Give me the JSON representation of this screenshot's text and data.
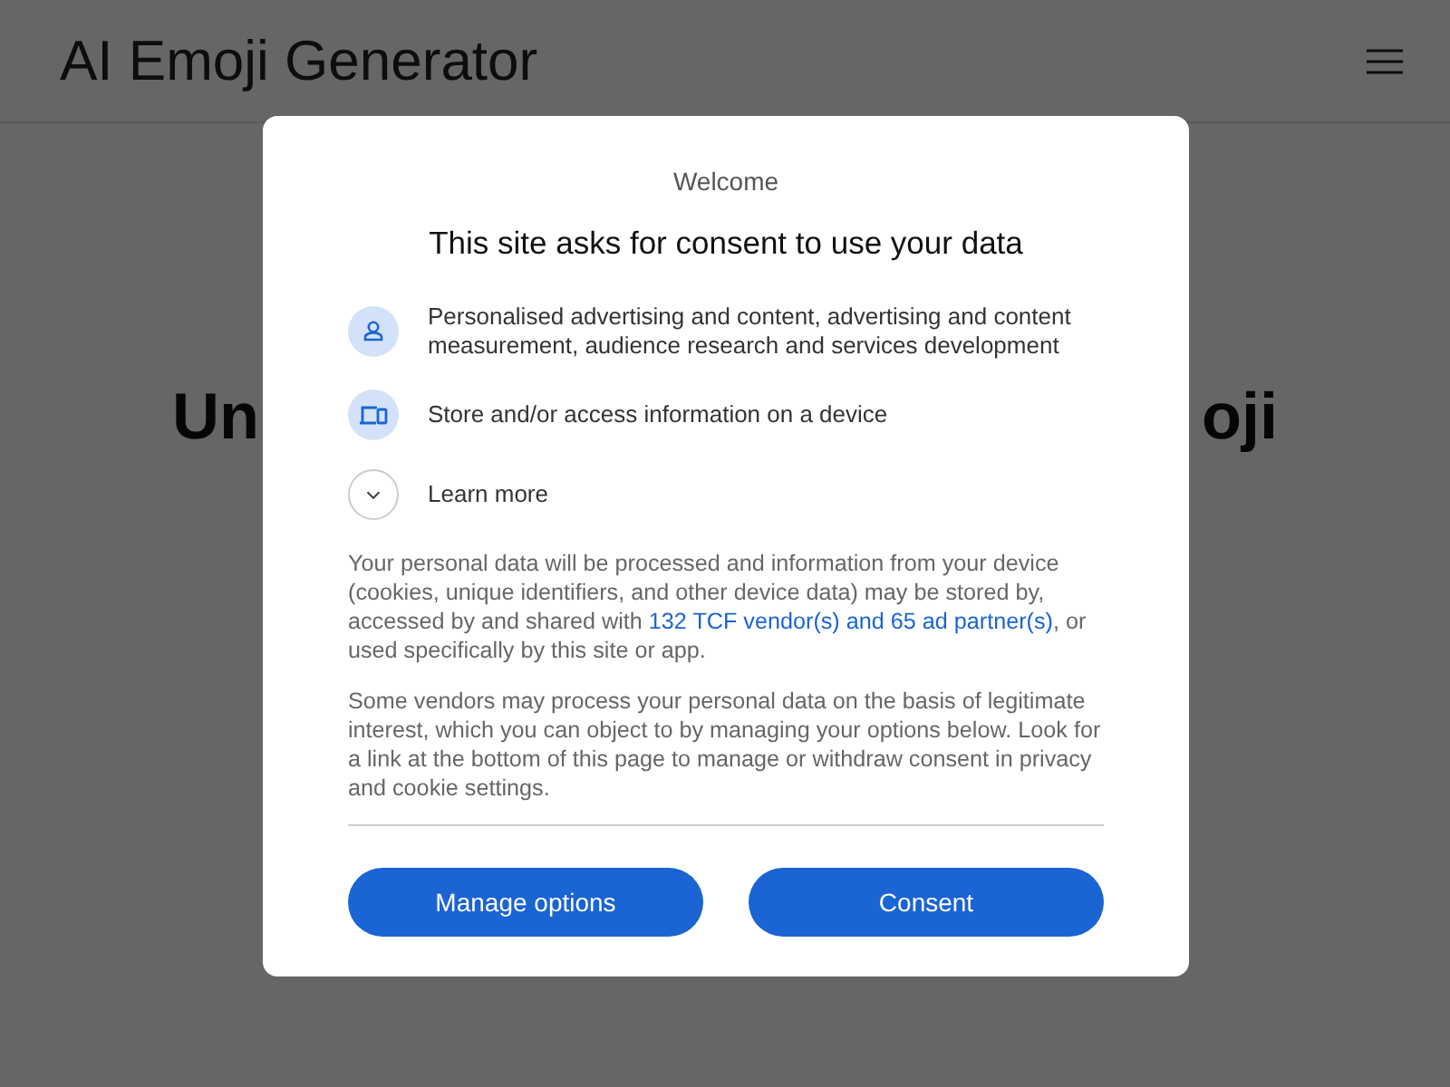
{
  "page": {
    "title": "AI Emoji Generator",
    "heading_left": "Un",
    "heading_right": "oji"
  },
  "dialog": {
    "eyebrow": "Welcome",
    "title": "This site asks for consent to use your data",
    "purposes": [
      {
        "kind": "person",
        "text": "Personalised advertising and content, advertising and content measurement, audience research and services development"
      },
      {
        "kind": "device",
        "text": "Store and/or access information on a device"
      }
    ],
    "learn_more": {
      "label": "Learn more",
      "expanded": false
    },
    "paragraphs": [
      {
        "before": "Your personal data will be processed and information from your device (cookies, unique identifiers, and other device data) may be stored by, accessed by and shared with ",
        "link": "132 TCF vendor(s) and 65 ad partner(s)",
        "after": ", or used specifically by this site or app."
      },
      {
        "before": "Some vendors may process your personal data on the basis of legitimate interest, which you can object to by managing your options below. Look for a link at the bottom of this page to manage or withdraw consent in privacy and cookie settings."
      }
    ],
    "buttons": [
      "Manage options",
      "Consent"
    ]
  }
}
